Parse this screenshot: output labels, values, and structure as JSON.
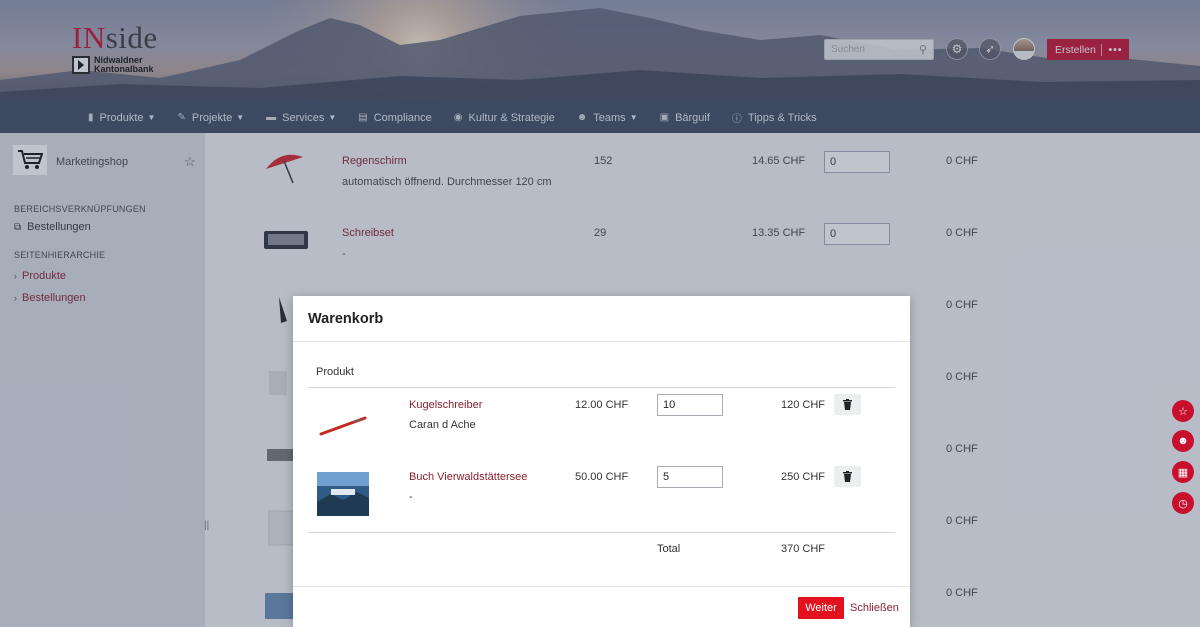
{
  "header": {
    "logo_in": "IN",
    "logo_side": "side",
    "bank_line1": "Nidwaldner",
    "bank_line2": "Kantonalbank",
    "search_placeholder": "Suchen",
    "create_label": "Erstellen",
    "more_label": "•••"
  },
  "nav": {
    "items": [
      {
        "label": "Produkte",
        "icon": "document-icon",
        "dropdown": true
      },
      {
        "label": "Projekte",
        "icon": "wrench-icon",
        "dropdown": true
      },
      {
        "label": "Services",
        "icon": "briefcase-icon",
        "dropdown": true
      },
      {
        "label": "Compliance",
        "icon": "book-icon",
        "dropdown": false
      },
      {
        "label": "Kultur & Strategie",
        "icon": "globe-icon",
        "dropdown": false
      },
      {
        "label": "Teams",
        "icon": "users-icon",
        "dropdown": true
      },
      {
        "label": "Bärguif",
        "icon": "newspaper-icon",
        "dropdown": false
      },
      {
        "label": "Tipps & Tricks",
        "icon": "info-icon",
        "dropdown": false
      }
    ]
  },
  "sidebar": {
    "title": "Marketingshop",
    "section_links_heading": "BEREICHSVERKNÜPFUNGEN",
    "section_link": "Bestellungen",
    "hierarchy_heading": "SEITENHIERARCHIE",
    "hierarchy": [
      "Produkte",
      "Bestellungen"
    ]
  },
  "products": [
    {
      "name": "Regenschirm",
      "desc": "automatisch öffnend. Durchmesser 120 cm",
      "stock": "152",
      "price": "14.65 CHF",
      "qty": "0",
      "total": "0 CHF"
    },
    {
      "name": "Schreibset",
      "desc": "-",
      "stock": "29",
      "price": "13.35 CHF",
      "qty": "0",
      "total": "0 CHF"
    },
    {
      "total": "0 CHF"
    },
    {
      "total": "0 CHF"
    },
    {
      "total": "0 CHF"
    },
    {
      "total": "0 CHF"
    },
    {
      "total": "0 CHF"
    }
  ],
  "modal": {
    "title": "Warenkorb",
    "col_product": "Produkt",
    "items": [
      {
        "name": "Kugelschreiber",
        "desc": "Caran d Ache",
        "price": "12.00 CHF",
        "qty": "10",
        "sum": "120 CHF"
      },
      {
        "name": "Buch Vierwaldstättersee",
        "desc": "-",
        "price": "50.00 CHF",
        "qty": "5",
        "sum": "250 CHF"
      }
    ],
    "total_label": "Total",
    "total_value": "370 CHF",
    "next_label": "Weiter",
    "close_label": "Schließen"
  }
}
